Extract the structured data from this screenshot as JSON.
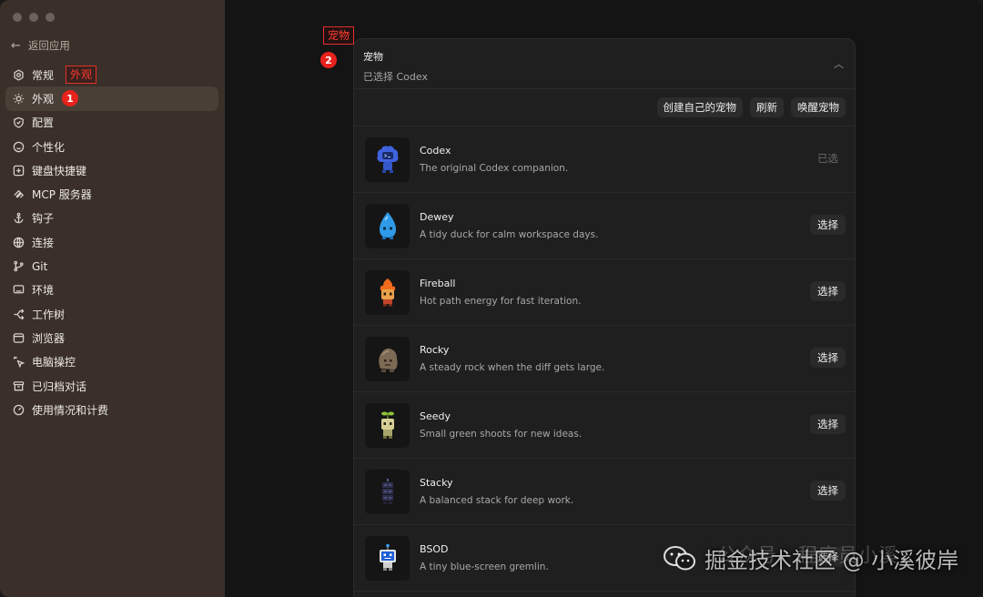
{
  "sidebar": {
    "back_label": "返回应用",
    "items": [
      {
        "label": "常规",
        "icon": "gear-icon"
      },
      {
        "label": "外观",
        "icon": "sun-icon"
      },
      {
        "label": "配置",
        "icon": "shield-icon"
      },
      {
        "label": "个性化",
        "icon": "smile-icon"
      },
      {
        "label": "键盘快捷键",
        "icon": "keyboard-icon"
      },
      {
        "label": "MCP 服务器",
        "icon": "mcp-icon"
      },
      {
        "label": "钩子",
        "icon": "anchor-icon"
      },
      {
        "label": "连接",
        "icon": "globe-icon"
      },
      {
        "label": "Git",
        "icon": "branch-icon"
      },
      {
        "label": "环境",
        "icon": "monitor-icon"
      },
      {
        "label": "工作树",
        "icon": "worktree-icon"
      },
      {
        "label": "浏览器",
        "icon": "browser-icon"
      },
      {
        "label": "电脑操控",
        "icon": "cursor-icon"
      },
      {
        "label": "已归档对话",
        "icon": "archive-icon"
      },
      {
        "label": "使用情况和计费",
        "icon": "gauge-icon"
      }
    ],
    "active_index": 1
  },
  "annotations": {
    "one": {
      "label": "外观",
      "badge": "1"
    },
    "two": {
      "label": "宠物",
      "badge": "2"
    }
  },
  "panel": {
    "title": "宠物",
    "subtitle": "已选择 Codex",
    "toolbar": {
      "create_label": "创建自己的宠物",
      "refresh_label": "刷新",
      "wake_label": "唤醒宠物"
    },
    "pets": [
      {
        "name": "Codex",
        "desc": "The original Codex companion.",
        "button": "已选",
        "selected": true
      },
      {
        "name": "Dewey",
        "desc": "A tidy duck for calm workspace days.",
        "button": "选择",
        "selected": false
      },
      {
        "name": "Fireball",
        "desc": "Hot path energy for fast iteration.",
        "button": "选择",
        "selected": false
      },
      {
        "name": "Rocky",
        "desc": "A steady rock when the diff gets large.",
        "button": "选择",
        "selected": false
      },
      {
        "name": "Seedy",
        "desc": "Small green shoots for new ideas.",
        "button": "选择",
        "selected": false
      },
      {
        "name": "Stacky",
        "desc": "A balanced stack for deep work.",
        "button": "选择",
        "selected": false
      },
      {
        "name": "BSOD",
        "desc": "A tiny blue-screen gremlin.",
        "button": "选择",
        "selected": false
      }
    ]
  },
  "watermark": {
    "text": "掘金技术社区 @ 小溪彼岸",
    "faint": "公众号 · 程序员小溪"
  },
  "colors": {
    "sidebar": "#3a3029",
    "panel": "#1f1f1f",
    "annotation": "#e8221c"
  }
}
